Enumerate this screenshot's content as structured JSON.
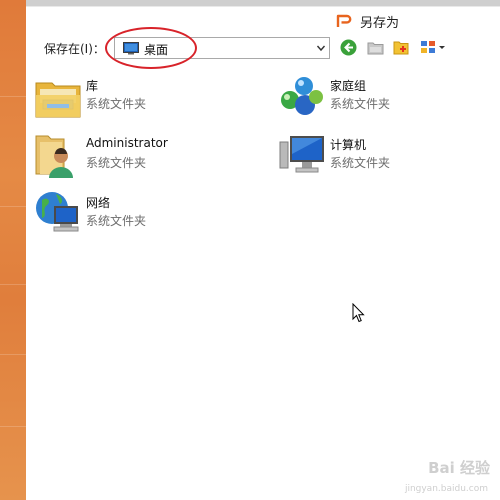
{
  "dialog": {
    "title": "另存为",
    "save_in_label": "保存在(I)：",
    "location": "桌面"
  },
  "icons": {
    "title_logo": "wps-logo-icon",
    "location": "desktop-icon",
    "back": "back-icon",
    "up_folder": "up-folder-icon",
    "new_folder": "new-folder-icon",
    "view_menu": "view-menu-icon"
  },
  "items": [
    {
      "name": "库",
      "type": "系统文件夹",
      "icon": "library-icon"
    },
    {
      "name": "家庭组",
      "type": "系统文件夹",
      "icon": "homegroup-icon"
    },
    {
      "name": "Administrator",
      "type": "系统文件夹",
      "icon": "user-folder-icon"
    },
    {
      "name": "计算机",
      "type": "系统文件夹",
      "icon": "computer-icon"
    },
    {
      "name": "网络",
      "type": "系统文件夹",
      "icon": "network-icon"
    }
  ],
  "watermark": {
    "text": "Bai 经验",
    "url": "jingyan.baidu.com"
  },
  "colors": {
    "accent": "#e8641e",
    "highlight": "#d8232a",
    "back_button": "#3aa13a"
  }
}
